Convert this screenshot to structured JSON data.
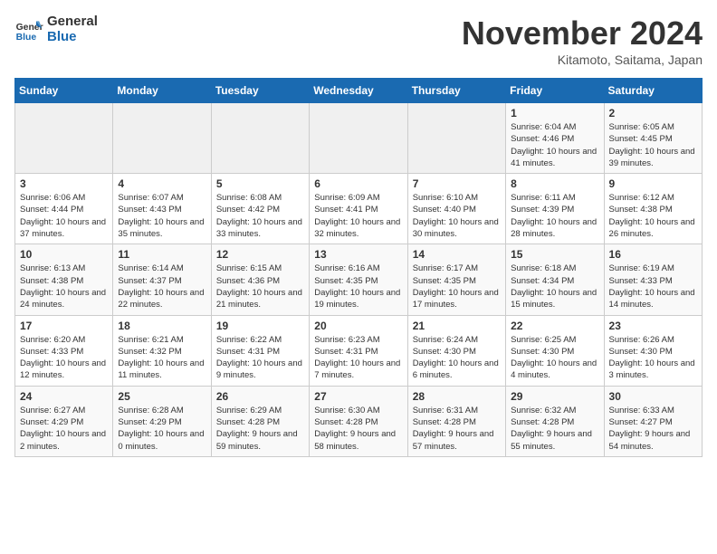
{
  "header": {
    "logo_line1": "General",
    "logo_line2": "Blue",
    "title": "November 2024",
    "subtitle": "Kitamoto, Saitama, Japan"
  },
  "days_of_week": [
    "Sunday",
    "Monday",
    "Tuesday",
    "Wednesday",
    "Thursday",
    "Friday",
    "Saturday"
  ],
  "weeks": [
    [
      {
        "day": "",
        "info": ""
      },
      {
        "day": "",
        "info": ""
      },
      {
        "day": "",
        "info": ""
      },
      {
        "day": "",
        "info": ""
      },
      {
        "day": "",
        "info": ""
      },
      {
        "day": "1",
        "info": "Sunrise: 6:04 AM\nSunset: 4:46 PM\nDaylight: 10 hours and 41 minutes."
      },
      {
        "day": "2",
        "info": "Sunrise: 6:05 AM\nSunset: 4:45 PM\nDaylight: 10 hours and 39 minutes."
      }
    ],
    [
      {
        "day": "3",
        "info": "Sunrise: 6:06 AM\nSunset: 4:44 PM\nDaylight: 10 hours and 37 minutes."
      },
      {
        "day": "4",
        "info": "Sunrise: 6:07 AM\nSunset: 4:43 PM\nDaylight: 10 hours and 35 minutes."
      },
      {
        "day": "5",
        "info": "Sunrise: 6:08 AM\nSunset: 4:42 PM\nDaylight: 10 hours and 33 minutes."
      },
      {
        "day": "6",
        "info": "Sunrise: 6:09 AM\nSunset: 4:41 PM\nDaylight: 10 hours and 32 minutes."
      },
      {
        "day": "7",
        "info": "Sunrise: 6:10 AM\nSunset: 4:40 PM\nDaylight: 10 hours and 30 minutes."
      },
      {
        "day": "8",
        "info": "Sunrise: 6:11 AM\nSunset: 4:39 PM\nDaylight: 10 hours and 28 minutes."
      },
      {
        "day": "9",
        "info": "Sunrise: 6:12 AM\nSunset: 4:38 PM\nDaylight: 10 hours and 26 minutes."
      }
    ],
    [
      {
        "day": "10",
        "info": "Sunrise: 6:13 AM\nSunset: 4:38 PM\nDaylight: 10 hours and 24 minutes."
      },
      {
        "day": "11",
        "info": "Sunrise: 6:14 AM\nSunset: 4:37 PM\nDaylight: 10 hours and 22 minutes."
      },
      {
        "day": "12",
        "info": "Sunrise: 6:15 AM\nSunset: 4:36 PM\nDaylight: 10 hours and 21 minutes."
      },
      {
        "day": "13",
        "info": "Sunrise: 6:16 AM\nSunset: 4:35 PM\nDaylight: 10 hours and 19 minutes."
      },
      {
        "day": "14",
        "info": "Sunrise: 6:17 AM\nSunset: 4:35 PM\nDaylight: 10 hours and 17 minutes."
      },
      {
        "day": "15",
        "info": "Sunrise: 6:18 AM\nSunset: 4:34 PM\nDaylight: 10 hours and 15 minutes."
      },
      {
        "day": "16",
        "info": "Sunrise: 6:19 AM\nSunset: 4:33 PM\nDaylight: 10 hours and 14 minutes."
      }
    ],
    [
      {
        "day": "17",
        "info": "Sunrise: 6:20 AM\nSunset: 4:33 PM\nDaylight: 10 hours and 12 minutes."
      },
      {
        "day": "18",
        "info": "Sunrise: 6:21 AM\nSunset: 4:32 PM\nDaylight: 10 hours and 11 minutes."
      },
      {
        "day": "19",
        "info": "Sunrise: 6:22 AM\nSunset: 4:31 PM\nDaylight: 10 hours and 9 minutes."
      },
      {
        "day": "20",
        "info": "Sunrise: 6:23 AM\nSunset: 4:31 PM\nDaylight: 10 hours and 7 minutes."
      },
      {
        "day": "21",
        "info": "Sunrise: 6:24 AM\nSunset: 4:30 PM\nDaylight: 10 hours and 6 minutes."
      },
      {
        "day": "22",
        "info": "Sunrise: 6:25 AM\nSunset: 4:30 PM\nDaylight: 10 hours and 4 minutes."
      },
      {
        "day": "23",
        "info": "Sunrise: 6:26 AM\nSunset: 4:30 PM\nDaylight: 10 hours and 3 minutes."
      }
    ],
    [
      {
        "day": "24",
        "info": "Sunrise: 6:27 AM\nSunset: 4:29 PM\nDaylight: 10 hours and 2 minutes."
      },
      {
        "day": "25",
        "info": "Sunrise: 6:28 AM\nSunset: 4:29 PM\nDaylight: 10 hours and 0 minutes."
      },
      {
        "day": "26",
        "info": "Sunrise: 6:29 AM\nSunset: 4:28 PM\nDaylight: 9 hours and 59 minutes."
      },
      {
        "day": "27",
        "info": "Sunrise: 6:30 AM\nSunset: 4:28 PM\nDaylight: 9 hours and 58 minutes."
      },
      {
        "day": "28",
        "info": "Sunrise: 6:31 AM\nSunset: 4:28 PM\nDaylight: 9 hours and 57 minutes."
      },
      {
        "day": "29",
        "info": "Sunrise: 6:32 AM\nSunset: 4:28 PM\nDaylight: 9 hours and 55 minutes."
      },
      {
        "day": "30",
        "info": "Sunrise: 6:33 AM\nSunset: 4:27 PM\nDaylight: 9 hours and 54 minutes."
      }
    ]
  ]
}
